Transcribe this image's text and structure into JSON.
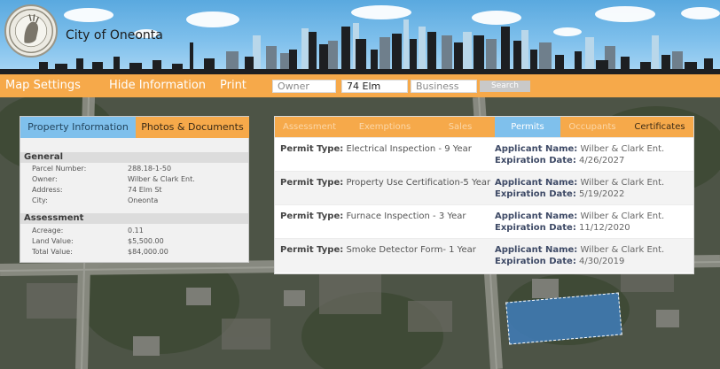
{
  "header": {
    "city_name": "City of Oneonta",
    "seal_icon": "city-seal-icon"
  },
  "nav": {
    "map_settings": "Map Settings",
    "hide_information": "Hide Information",
    "print": "Print",
    "owner_placeholder": "Owner",
    "address_value": "74 Elm",
    "business_placeholder": "Business",
    "search_label": "Search"
  },
  "property_panel": {
    "tabs": [
      "Property Information",
      "Photos & Documents"
    ],
    "general_heading": "General",
    "general": [
      {
        "label": "Parcel Number:",
        "value": "288.18-1-50"
      },
      {
        "label": "Owner:",
        "value": "Wilber & Clark Ent."
      },
      {
        "label": "Address:",
        "value": "74 Elm St"
      },
      {
        "label": "City:",
        "value": "Oneonta"
      }
    ],
    "assessment_heading": "Assessment",
    "assessment": [
      {
        "label": "Acreage:",
        "value": "0.11"
      },
      {
        "label": "Land Value:",
        "value": "$5,500.00"
      },
      {
        "label": "Total Value:",
        "value": "$84,000.00"
      }
    ]
  },
  "permit_panel": {
    "tabs": [
      "Assessment",
      "Exemptions",
      "Sales",
      "Permits",
      "Occupants",
      "Certificates"
    ],
    "active_tab": "Permits",
    "labels": {
      "permit_type": "Permit Type:",
      "applicant_name": "Applicant Name:",
      "expiration_date": "Expiration Date:"
    },
    "permits": [
      {
        "type": "Electrical Inspection - 9 Year",
        "applicant": "Wilber & Clark Ent.",
        "expiration": "4/26/2027"
      },
      {
        "type": "Property Use Certification-5 Year",
        "applicant": "Wilber & Clark Ent.",
        "expiration": "5/19/2022"
      },
      {
        "type": "Furnace Inspection - 3 Year",
        "applicant": "Wilber & Clark Ent.",
        "expiration": "11/12/2020"
      },
      {
        "type": "Smoke Detector Form- 1 Year",
        "applicant": "Wilber & Clark Ent.",
        "expiration": "4/30/2019"
      }
    ]
  },
  "colors": {
    "nav_orange": "#f6a94a",
    "tab_blue": "#7fc0ec",
    "sky_blue": "#5aa9df",
    "parcel_blue": "#407cba"
  }
}
